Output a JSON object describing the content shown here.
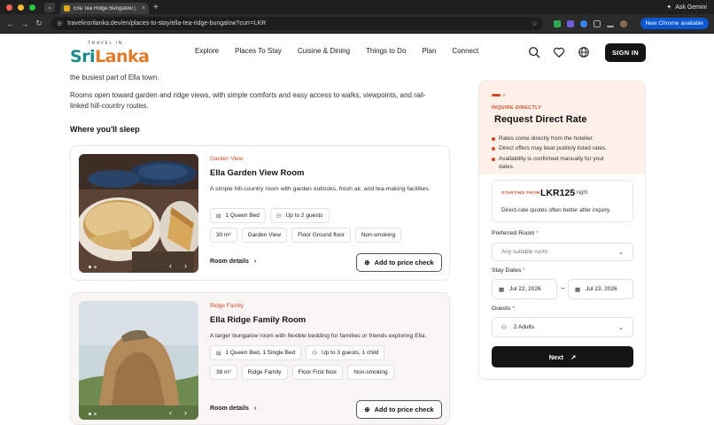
{
  "browser": {
    "tab_title": "Ella Tea Ridge Bungalow | Tea",
    "url": "travelinsrilanka.dev/en/places-to-stay/ella-tea-ridge-bungalow?curr=LKR",
    "update_label": "New Chrome available",
    "gemini_label": "Ask Gemini"
  },
  "site": {
    "logo_top": "TRAVEL IN",
    "logo_part1": "Sri",
    "logo_part2": "Lanka",
    "nav": [
      "Explore",
      "Places To Stay",
      "Cuisine & Dining",
      "Things to Do",
      "Plan",
      "Connect"
    ],
    "signin_label": "SIGN IN"
  },
  "intro": {
    "line1": "the busiest part of Ella town.",
    "para2_line1": "Rooms open toward garden and ridge views, with simple comforts and easy access to walks, viewpoints, and rail-",
    "para2_line2": "linked hill-country routes.",
    "section_heading": "Where you'll sleep"
  },
  "rooms": [
    {
      "tag": "Garden View",
      "title": "Ella Garden View Room",
      "desc": "A simple hill-country room with garden outlooks, fresh air, and tea-making facilities.",
      "bed": "1 Queen Bed",
      "guests": "Up to 2 guests",
      "features": [
        "30 m²",
        "Garden View",
        "Floor Ground floor",
        "Non-smoking"
      ],
      "details_label": "Room details",
      "price_check_label": "Add to price check"
    },
    {
      "tag": "Ridge Family",
      "title": "Ella Ridge Family Room",
      "desc": "A larger bungalow room with flexible bedding for families or friends exploring Ella.",
      "bed": "1 Queen Bed, 1 Single Bed",
      "guests": "Up to 3 guests, 1 child",
      "features": [
        "38 m²",
        "Ridge Family",
        "Floor First floor",
        "Non-smoking"
      ],
      "details_label": "Room details",
      "price_check_label": "Add to price check"
    }
  ],
  "panel": {
    "eyebrow": "INQUIRE DIRECTLY",
    "title": "Request Direct Rate",
    "bullets": [
      "Rates come directly from the hotelier.",
      "Direct offers may beat publicly listed rates.",
      "Availability is confirmed manually for your",
      "dates."
    ],
    "starting_from": "STARTING FROM",
    "price": "LKR125",
    "per": "/ night",
    "price_note": "Direct-rate quotes often better after inquiry.",
    "room_label": "Preferred Room",
    "room_value": "Any suitable room",
    "dates_label": "Stay Dates",
    "date_from": "Jul 22, 2026",
    "date_to": "Jul 23, 2026",
    "dash": "–",
    "guests_label": "Guests",
    "guests_value": "2 Adults",
    "required_mark": "*",
    "next_label": "Next"
  },
  "colors": {
    "accent": "#d04a2a",
    "dark": "#141414",
    "panel_tint": "#fdf1ea"
  }
}
